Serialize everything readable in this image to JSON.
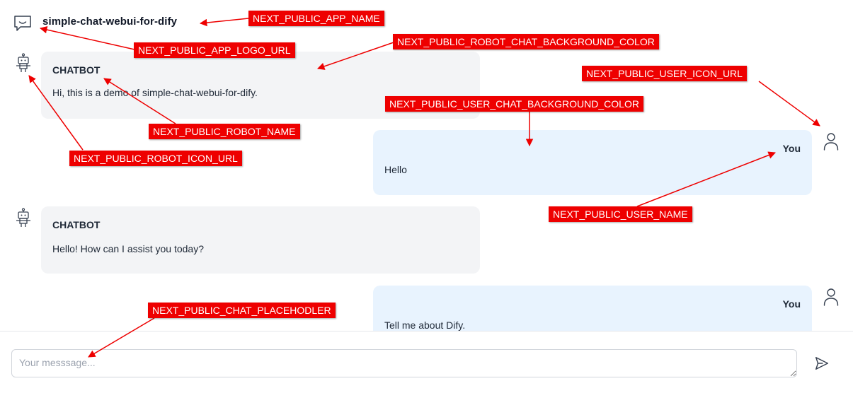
{
  "header": {
    "app_name": "simple-chat-webui-for-dify",
    "logo_icon": "chat-smile-icon"
  },
  "messages": [
    {
      "role": "robot",
      "sender": "CHATBOT",
      "text": "Hi, this is a demo of simple-chat-webui-for-dify."
    },
    {
      "role": "user",
      "sender": "You",
      "text": "Hello"
    },
    {
      "role": "robot",
      "sender": "CHATBOT",
      "text": "Hello! How can I assist you today?"
    },
    {
      "role": "user",
      "sender": "You",
      "text": "Tell me about Dify."
    }
  ],
  "composer": {
    "placeholder": "Your messsage...",
    "send_icon": "send-icon"
  },
  "annotations": {
    "app_name": "NEXT_PUBLIC_APP_NAME",
    "app_logo_url": "NEXT_PUBLIC_APP_LOGO_URL",
    "robot_chat_bg": "NEXT_PUBLIC_ROBOT_CHAT_BACKGROUND_COLOR",
    "user_icon_url": "NEXT_PUBLIC_USER_ICON_URL",
    "user_chat_bg": "NEXT_PUBLIC_USER_CHAT_BACKGROUND_COLOR",
    "robot_name": "NEXT_PUBLIC_ROBOT_NAME",
    "robot_icon_url": "NEXT_PUBLIC_ROBOT_ICON_URL",
    "user_name": "NEXT_PUBLIC_USER_NAME",
    "chat_placeholder": "NEXT_PUBLIC_CHAT_PLACEHODLER"
  },
  "colors": {
    "robot_bubble": "#f3f4f6",
    "user_bubble": "#e8f3fe",
    "annotation": "#ee0000"
  }
}
